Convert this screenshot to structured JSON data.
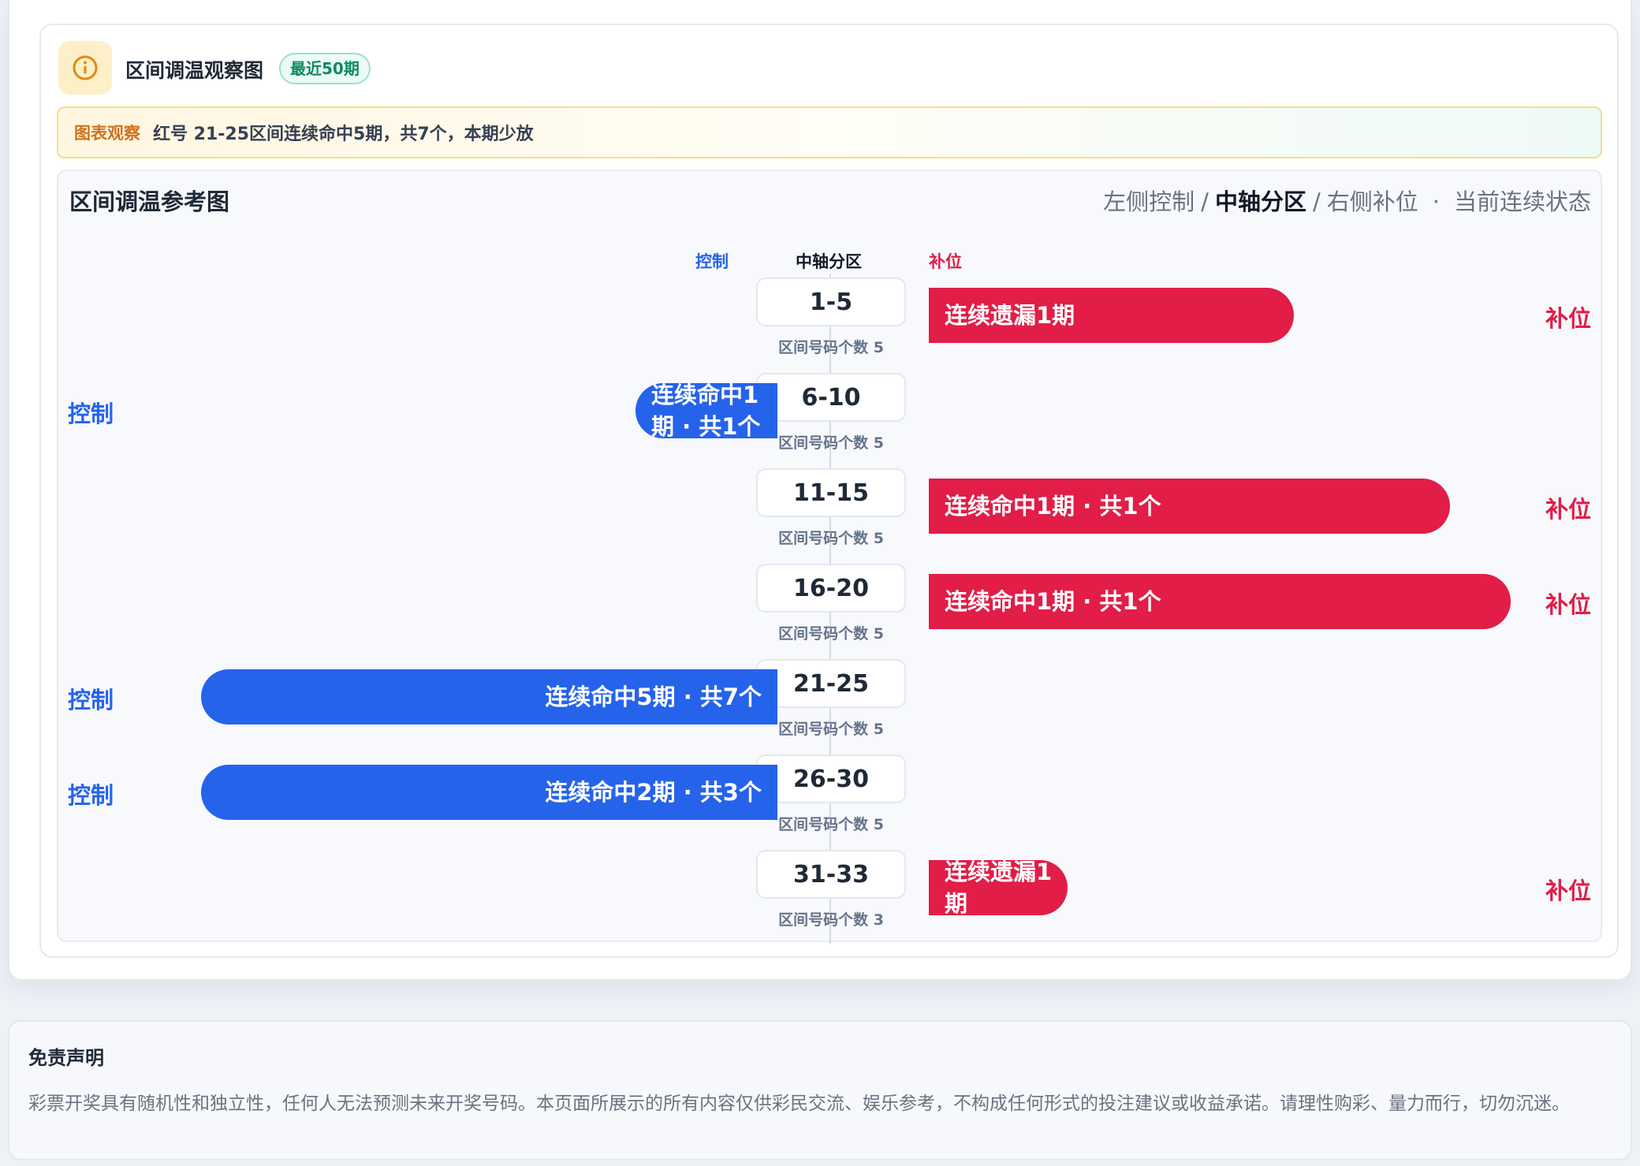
{
  "panel": {
    "title": "区间调温观察图",
    "badge": "最近50期",
    "icon": "info-icon"
  },
  "observation": {
    "label": "图表观察",
    "text": "红号 21-25区间连续命中5期，共7个，本期少放"
  },
  "chart": {
    "heading": "区间调温参考图",
    "legend": {
      "left": "左侧控制",
      "sep1": "/",
      "middle": "中轴分区",
      "sep2": "/",
      "right": "右侧补位",
      "dot": "·",
      "state": "当前连续状态"
    },
    "columns": {
      "control": "控制",
      "axis": "中轴分区",
      "fill": "补位"
    }
  },
  "chart_data": {
    "type": "bar",
    "title": "区间调温参考图",
    "categories": [
      "1-5",
      "6-10",
      "11-15",
      "16-20",
      "21-25",
      "26-30",
      "31-33"
    ],
    "counts": [
      "区间号码个数 5",
      "区间号码个数 5",
      "区间号码个数 5",
      "区间号码个数 5",
      "区间号码个数 5",
      "区间号码个数 5",
      "区间号码个数 3"
    ],
    "rows": [
      {
        "zone": "1-5",
        "side": "fill",
        "label": "连续遗漏1期",
        "side_label": "补位",
        "strength": 0.42
      },
      {
        "zone": "6-10",
        "side": "control",
        "label": "连续命中1期 · 共1个",
        "side_label": "控制",
        "strength": 0.18
      },
      {
        "zone": "11-15",
        "side": "fill",
        "label": "连续命中1期 · 共1个",
        "side_label": "补位",
        "strength": 0.6
      },
      {
        "zone": "16-20",
        "side": "fill",
        "label": "连续命中1期 · 共1个",
        "side_label": "补位",
        "strength": 0.67
      },
      {
        "zone": "21-25",
        "side": "control",
        "label": "连续命中5期 · 共7个",
        "side_label": "控制",
        "strength": 0.73
      },
      {
        "zone": "26-30",
        "side": "control",
        "label": "连续命中2期 · 共3个",
        "side_label": "控制",
        "strength": 0.73
      },
      {
        "zone": "31-33",
        "side": "fill",
        "label": "连续遗漏1期",
        "side_label": "补位",
        "strength": 0.16
      }
    ],
    "colors": {
      "control": "#2563eb",
      "fill": "#e11d48"
    }
  },
  "disclaimer": {
    "title": "免责声明",
    "text": "彩票开奖具有随机性和独立性，任何人无法预测未来开奖号码。本页面所展示的所有内容仅供彩民交流、娱乐参考，不构成任何形式的投注建议或收益承诺。请理性购彩、量力而行，切勿沉迷。"
  }
}
